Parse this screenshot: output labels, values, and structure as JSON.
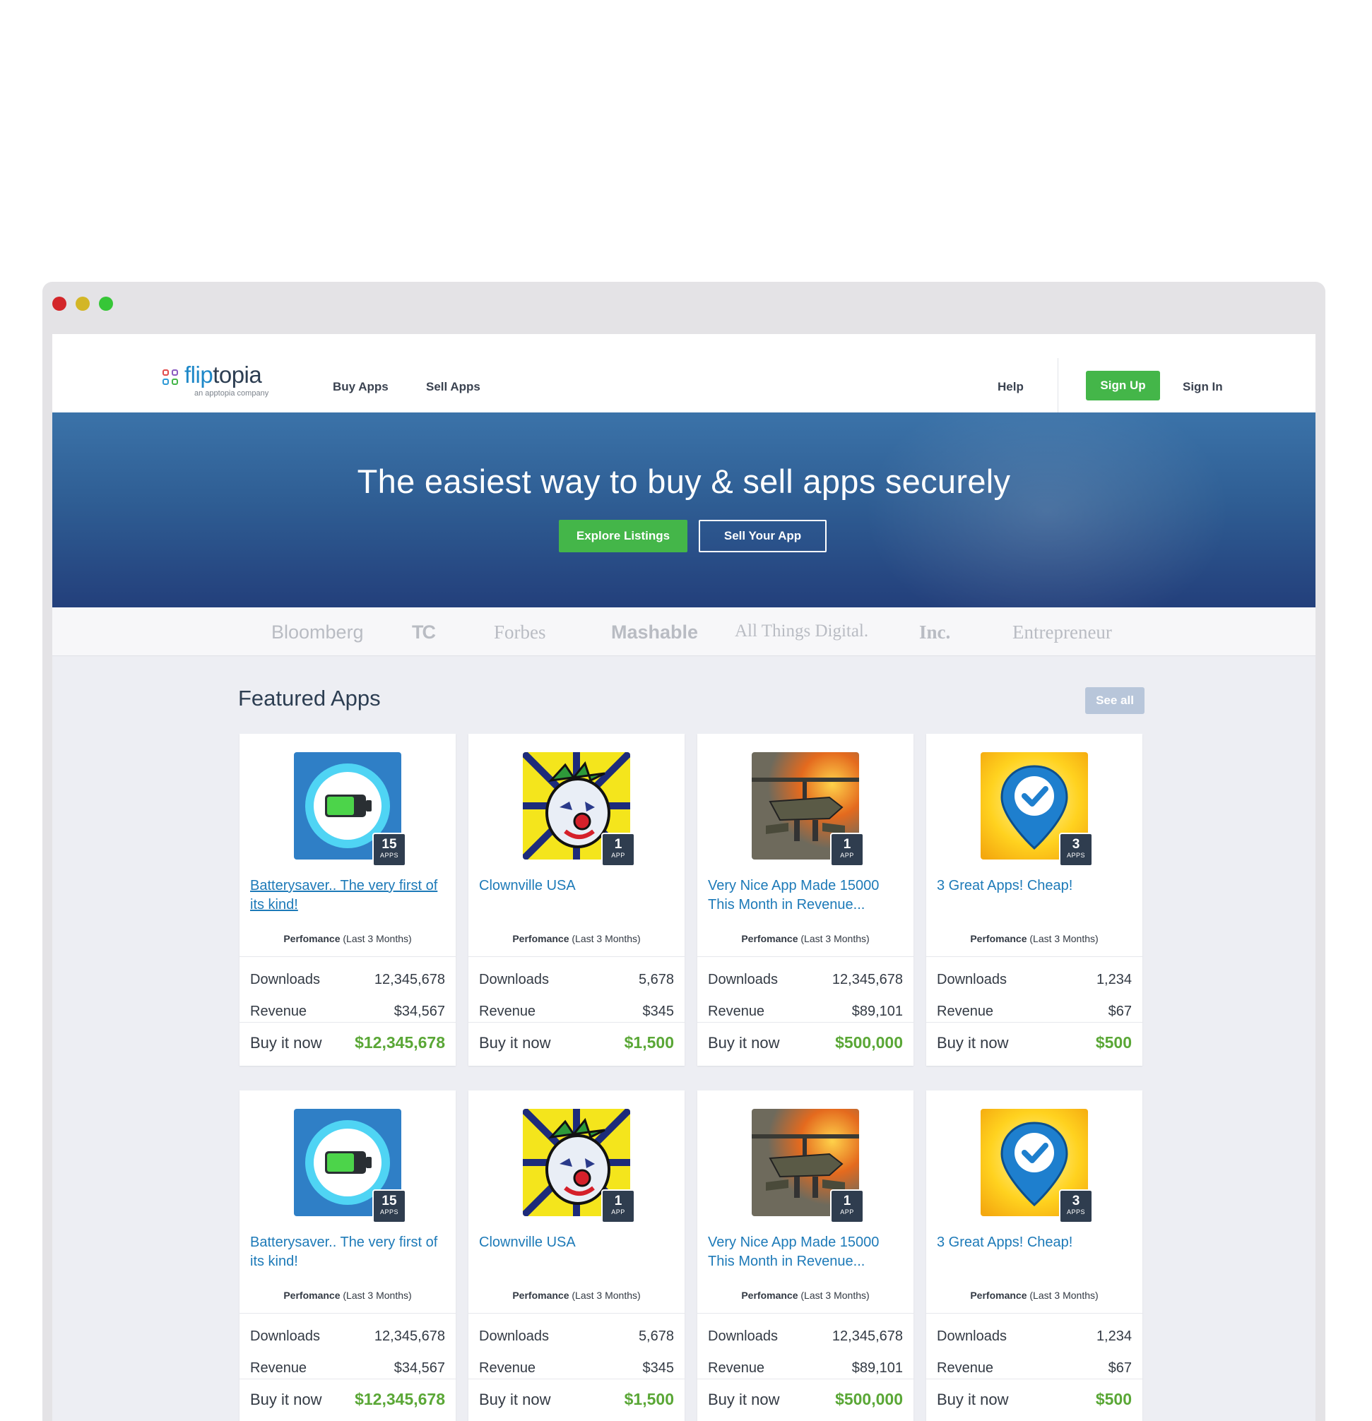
{
  "nav": {
    "logo_word_a": "flip",
    "logo_word_b": "topia",
    "logo_sub": "an apptopia company",
    "buy_apps": "Buy Apps",
    "sell_apps": "Sell Apps",
    "help": "Help",
    "sign_up": "Sign Up",
    "sign_in": "Sign In"
  },
  "hero": {
    "title": "The easiest way to buy & sell apps securely",
    "explore": "Explore Listings",
    "sell": "Sell Your App"
  },
  "press": [
    "Bloomberg",
    "TC",
    "Forbes",
    "Mashable",
    "All Things Digital.",
    "Inc.",
    "Entrepreneur"
  ],
  "featured": {
    "title": "Featured Apps",
    "see_all": "See all",
    "perf_bold": "Perfomance",
    "perf_rest": " (Last 3 Months)",
    "downloads_label": "Downloads",
    "revenue_label": "Revenue",
    "buy_label": "Buy it now",
    "cards": [
      {
        "title": "Batterysaver.. The very first of its kind!",
        "count": "15",
        "unit": "APPS",
        "downloads": "12,345,678",
        "revenue": "$34,567",
        "price": "$12,345,678",
        "icon": "battery-icon"
      },
      {
        "title": "Clownville USA",
        "count": "1",
        "unit": "APP",
        "downloads": "5,678",
        "revenue": "$345",
        "price": "$1,500",
        "icon": "clown-icon"
      },
      {
        "title": "Very Nice App Made 15000 This Month in Revenue...",
        "count": "1",
        "unit": "APP",
        "downloads": "12,345,678",
        "revenue": "$89,101",
        "price": "$500,000",
        "icon": "helicopter-icon"
      },
      {
        "title": "3 Great Apps! Cheap!",
        "count": "3",
        "unit": "APPS",
        "downloads": "1,234",
        "revenue": "$67",
        "price": "$500",
        "icon": "location-check-icon"
      },
      {
        "title": "Batterysaver.. The very first of its kind!",
        "count": "15",
        "unit": "APPS",
        "downloads": "12,345,678",
        "revenue": "$34,567",
        "price": "$12,345,678",
        "icon": "battery-icon"
      },
      {
        "title": "Clownville USA",
        "count": "1",
        "unit": "APP",
        "downloads": "5,678",
        "revenue": "$345",
        "price": "$1,500",
        "icon": "clown-icon"
      },
      {
        "title": "Very Nice App Made 15000 This Month in Revenue...",
        "count": "1",
        "unit": "APP",
        "downloads": "12,345,678",
        "revenue": "$89,101",
        "price": "$500,000",
        "icon": "helicopter-icon"
      },
      {
        "title": "3 Great Apps! Cheap!",
        "count": "3",
        "unit": "APPS",
        "downloads": "1,234",
        "revenue": "$67",
        "price": "$500",
        "icon": "location-check-icon"
      }
    ]
  },
  "colors": {
    "accent_green": "#44b649",
    "price_green": "#5aa736",
    "link_blue": "#1d7ab8",
    "hero_blue": "#2f5e94"
  }
}
